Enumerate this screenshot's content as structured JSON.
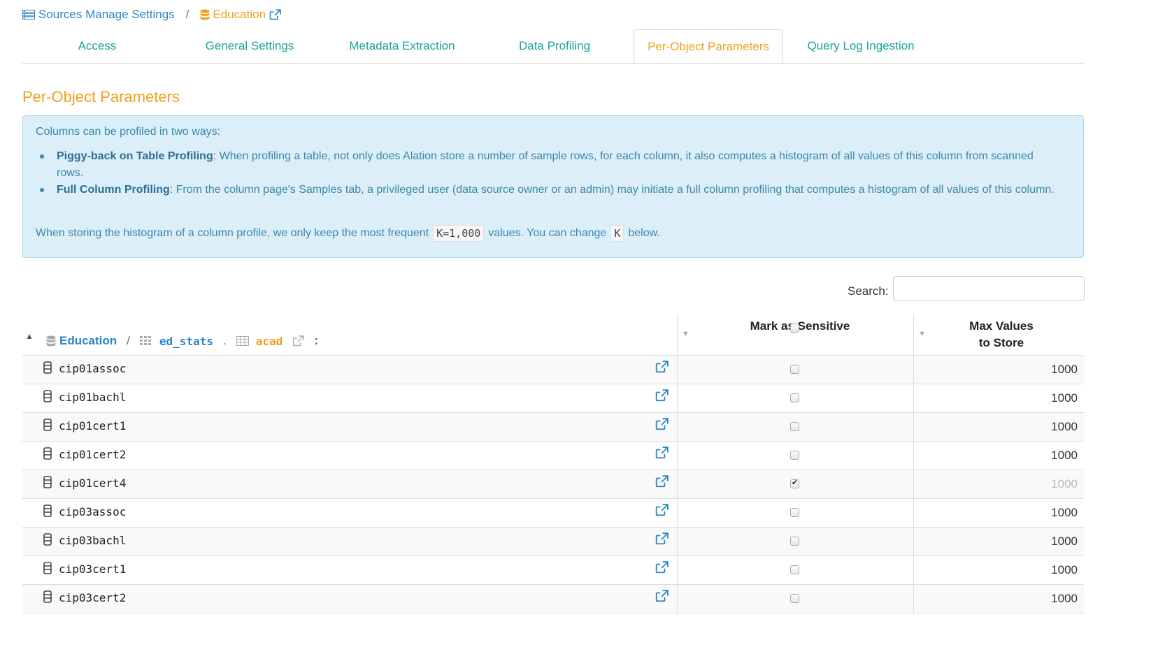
{
  "breadcrumb": {
    "root": "Sources Manage Settings",
    "separator": "/",
    "current": "Education"
  },
  "tabs": [
    {
      "label": "Access",
      "active": false
    },
    {
      "label": "General Settings",
      "active": false
    },
    {
      "label": "Metadata Extraction",
      "active": false
    },
    {
      "label": "Data Profiling",
      "active": false
    },
    {
      "label": "Per-Object Parameters",
      "active": true
    },
    {
      "label": "Query Log Ingestion",
      "active": false
    }
  ],
  "section_title": "Per-Object Parameters",
  "info": {
    "intro": "Columns can be profiled in two ways:",
    "bullets": [
      {
        "title": "Piggy-back on Table Profiling",
        "text": ": When profiling a table, not only does Alation store a number of sample rows, for each column, it also computes a histogram of all values of this column from scanned rows."
      },
      {
        "title": "Full Column Profiling",
        "text": ": From the column page's Samples tab, a privileged user (data source owner or an admin) may initiate a full column profiling that computes a histogram of all values of this column."
      }
    ],
    "foot_pre": "When storing the histogram of a column profile, we only keep the most frequent",
    "foot_code1": "K=1,000",
    "foot_mid": "values. You can change",
    "foot_code2": "K",
    "foot_post": "below."
  },
  "search": {
    "label": "Search:",
    "placeholder": "",
    "value": ""
  },
  "table": {
    "path": {
      "database": "Education",
      "sep1": "/",
      "schema": "ed_stats",
      "sep2": ".",
      "table": "acad",
      "colon": ":"
    },
    "headers": {
      "sensitive": "Mark as Sensitive",
      "max_values_line1": "Max Values",
      "max_values_line2": "to Store"
    },
    "rows": [
      {
        "name": "cip01assoc",
        "sensitive": false,
        "max": "1000"
      },
      {
        "name": "cip01bachl",
        "sensitive": false,
        "max": "1000"
      },
      {
        "name": "cip01cert1",
        "sensitive": false,
        "max": "1000"
      },
      {
        "name": "cip01cert2",
        "sensitive": false,
        "max": "1000"
      },
      {
        "name": "cip01cert4",
        "sensitive": true,
        "max": "1000"
      },
      {
        "name": "cip03assoc",
        "sensitive": false,
        "max": "1000"
      },
      {
        "name": "cip03bachl",
        "sensitive": false,
        "max": "1000"
      },
      {
        "name": "cip03cert1",
        "sensitive": false,
        "max": "1000"
      },
      {
        "name": "cip03cert2",
        "sensitive": false,
        "max": "1000"
      }
    ]
  },
  "colors": {
    "teal": "#1aa39b",
    "orange": "#f0a020",
    "blue": "#2a85c4",
    "info_bg": "#dceef8"
  }
}
